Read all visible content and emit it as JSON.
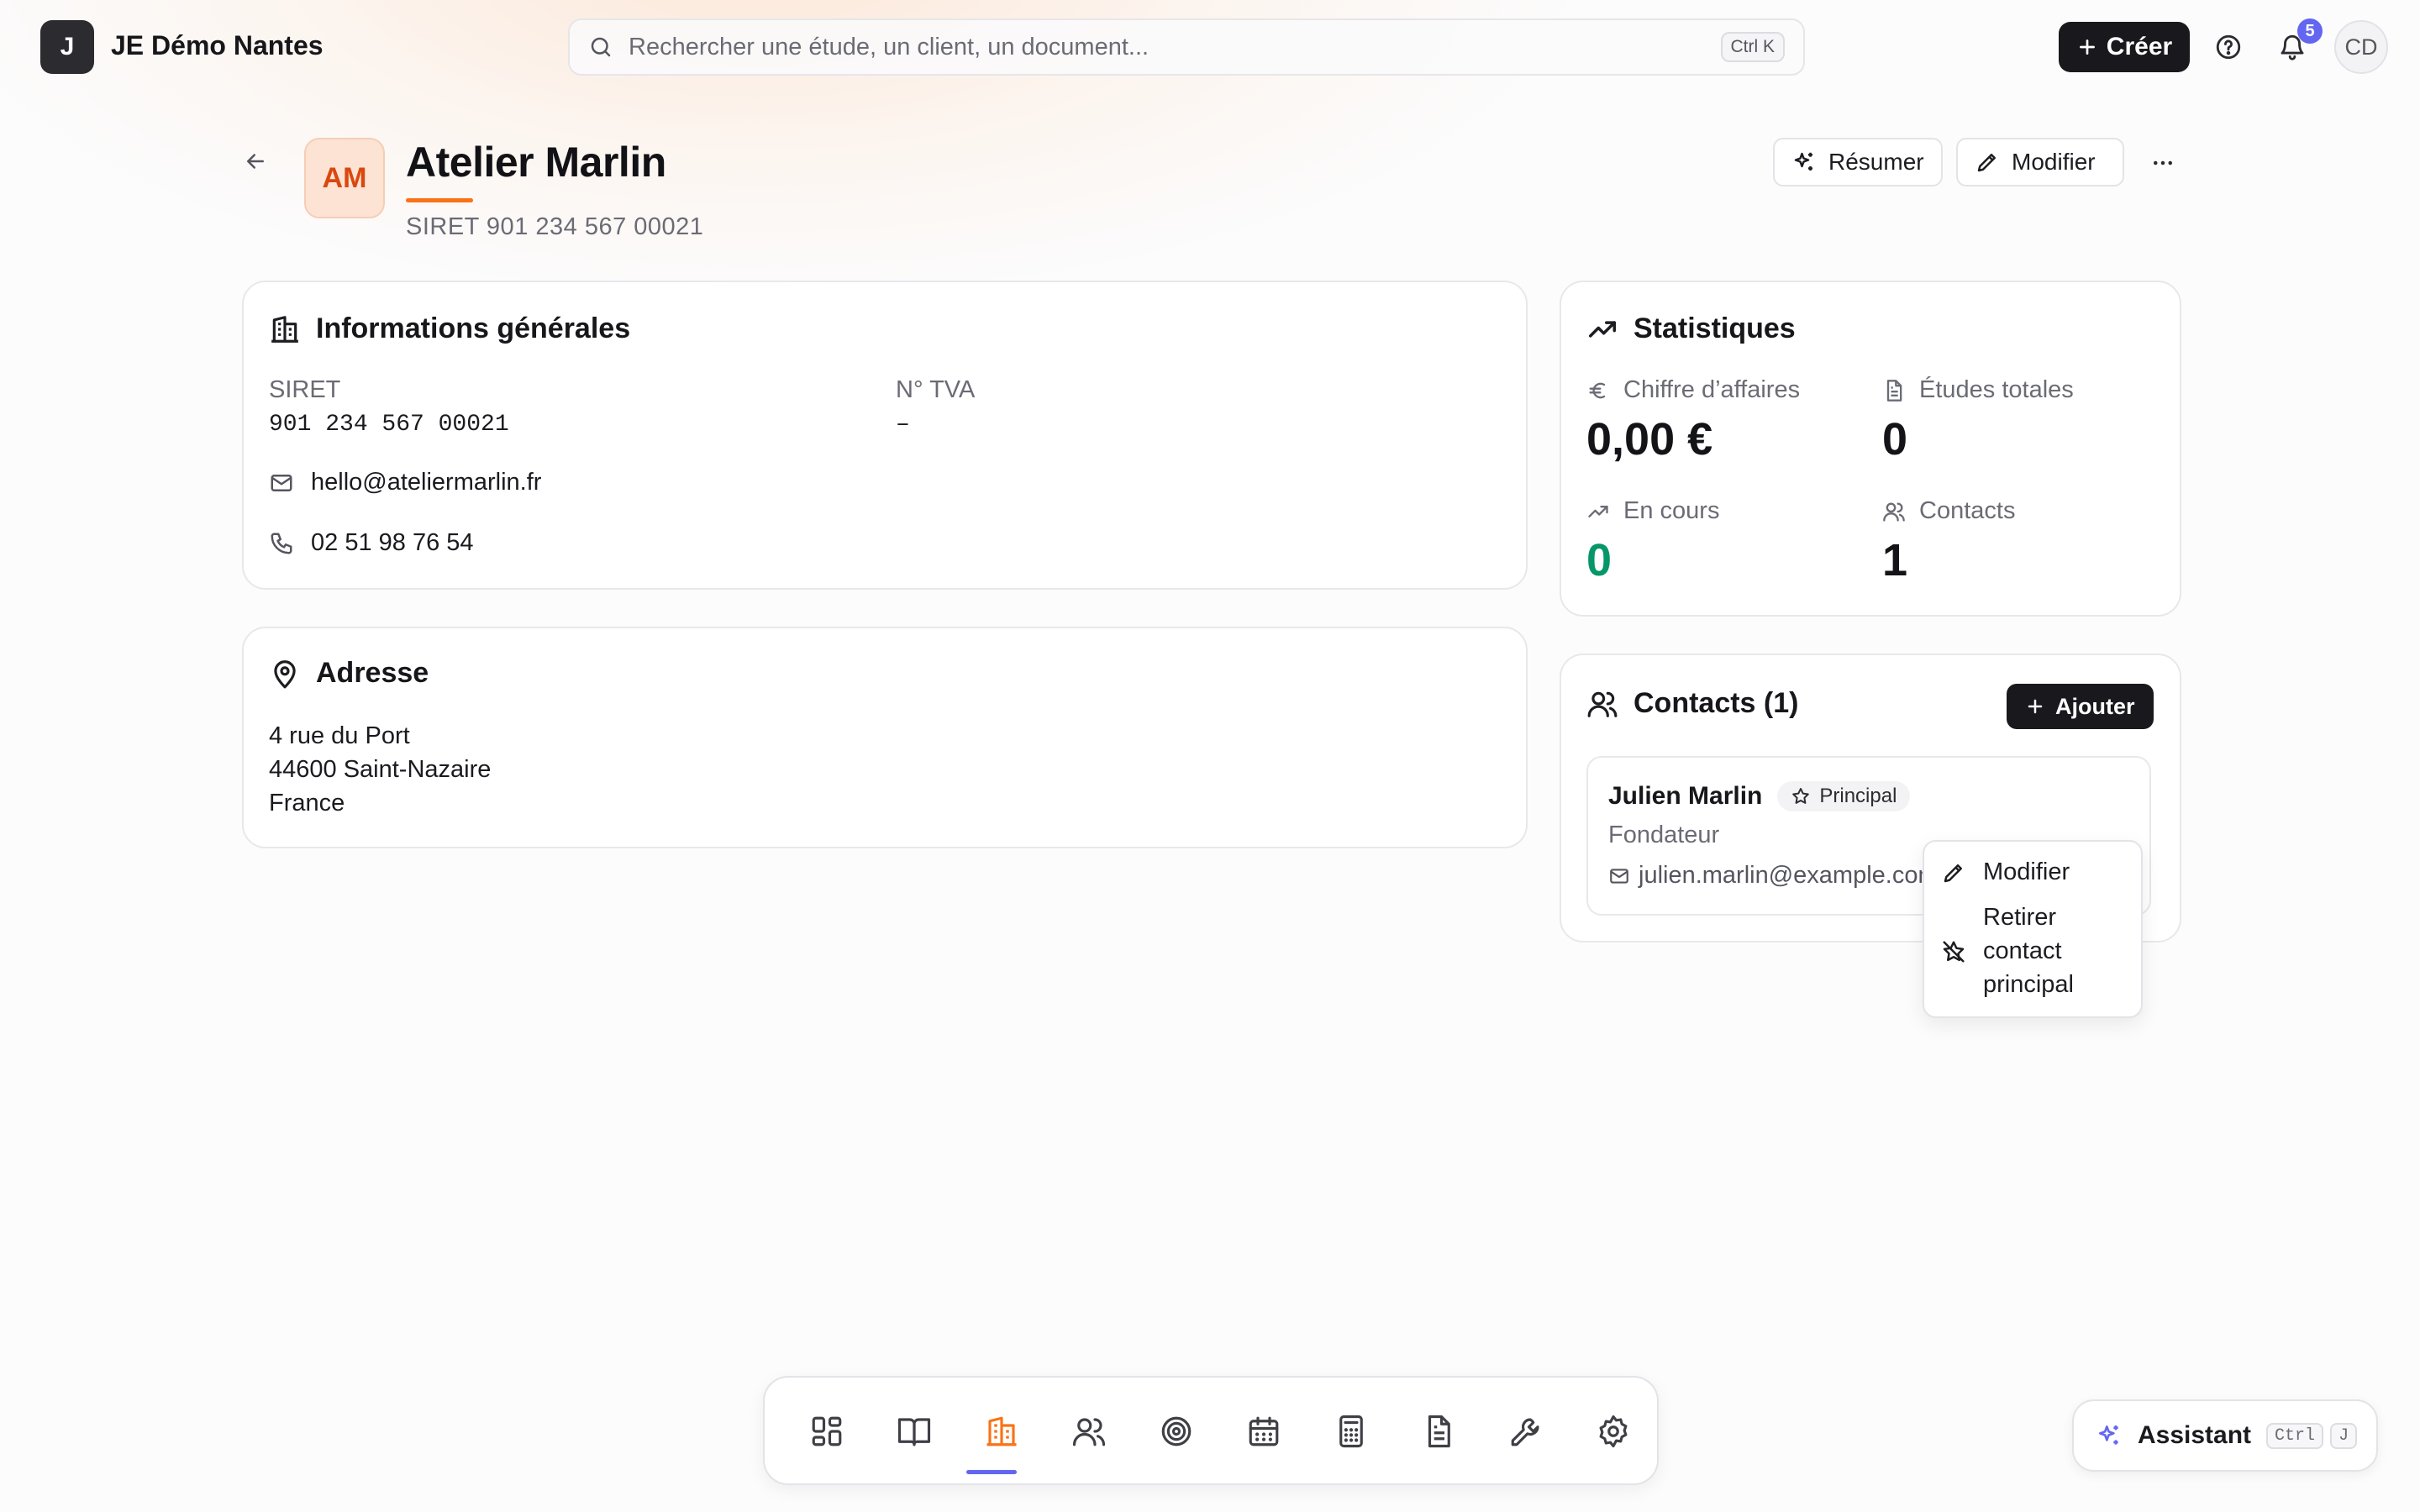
{
  "topbar": {
    "logo_letter": "J",
    "org_name": "JE Démo Nantes",
    "search_placeholder": "Rechercher une étude, un client, un document...",
    "search_shortcut": "Ctrl K",
    "create_label": "Créer",
    "notif_count": "5",
    "user_initials": "CD"
  },
  "header": {
    "initials": "AM",
    "name": "Atelier Marlin",
    "siret_line": "SIRET 901 234 567 00021",
    "summarize_label": "Résumer",
    "edit_label": "Modifier"
  },
  "general_info": {
    "title": "Informations générales",
    "siret_label": "SIRET",
    "siret_value": "901 234 567 00021",
    "vat_label": "N° TVA",
    "vat_value": "–",
    "email": "hello@ateliermarlin.fr",
    "phone": "02 51 98 76 54"
  },
  "address": {
    "title": "Adresse",
    "line1": "4 rue du Port",
    "line2": "44600 Saint-Nazaire",
    "line3": "France"
  },
  "stats": {
    "title": "Statistiques",
    "revenue_label": "Chiffre d’affaires",
    "revenue_value": "0,00 €",
    "studies_label": "Études totales",
    "studies_value": "0",
    "ongoing_label": "En cours",
    "ongoing_value": "0",
    "contacts_label": "Contacts",
    "contacts_value": "1",
    "accent_green": "#059669"
  },
  "contacts": {
    "title": "Contacts (1)",
    "add_label": "Ajouter",
    "items": [
      {
        "name": "Julien Marlin",
        "badge": "Principal",
        "role": "Fondateur",
        "email": "julien.marlin@example.com"
      }
    ]
  },
  "context_menu": {
    "edit_label": "Modifier",
    "remove_line1": "Retirer",
    "remove_line2": "contact",
    "remove_line3": "principal"
  },
  "dock": {
    "items": [
      "dashboard-icon",
      "book-icon",
      "building-icon",
      "users-icon",
      "target-icon",
      "calendar-icon",
      "calculator-icon",
      "document-icon",
      "wrench-icon",
      "settings-icon"
    ],
    "active_index": 2,
    "active_color": "#f97316",
    "indicator_color": "#6366f1"
  },
  "assistant": {
    "label": "Assistant",
    "kbd1": "Ctrl",
    "kbd2": "J"
  }
}
